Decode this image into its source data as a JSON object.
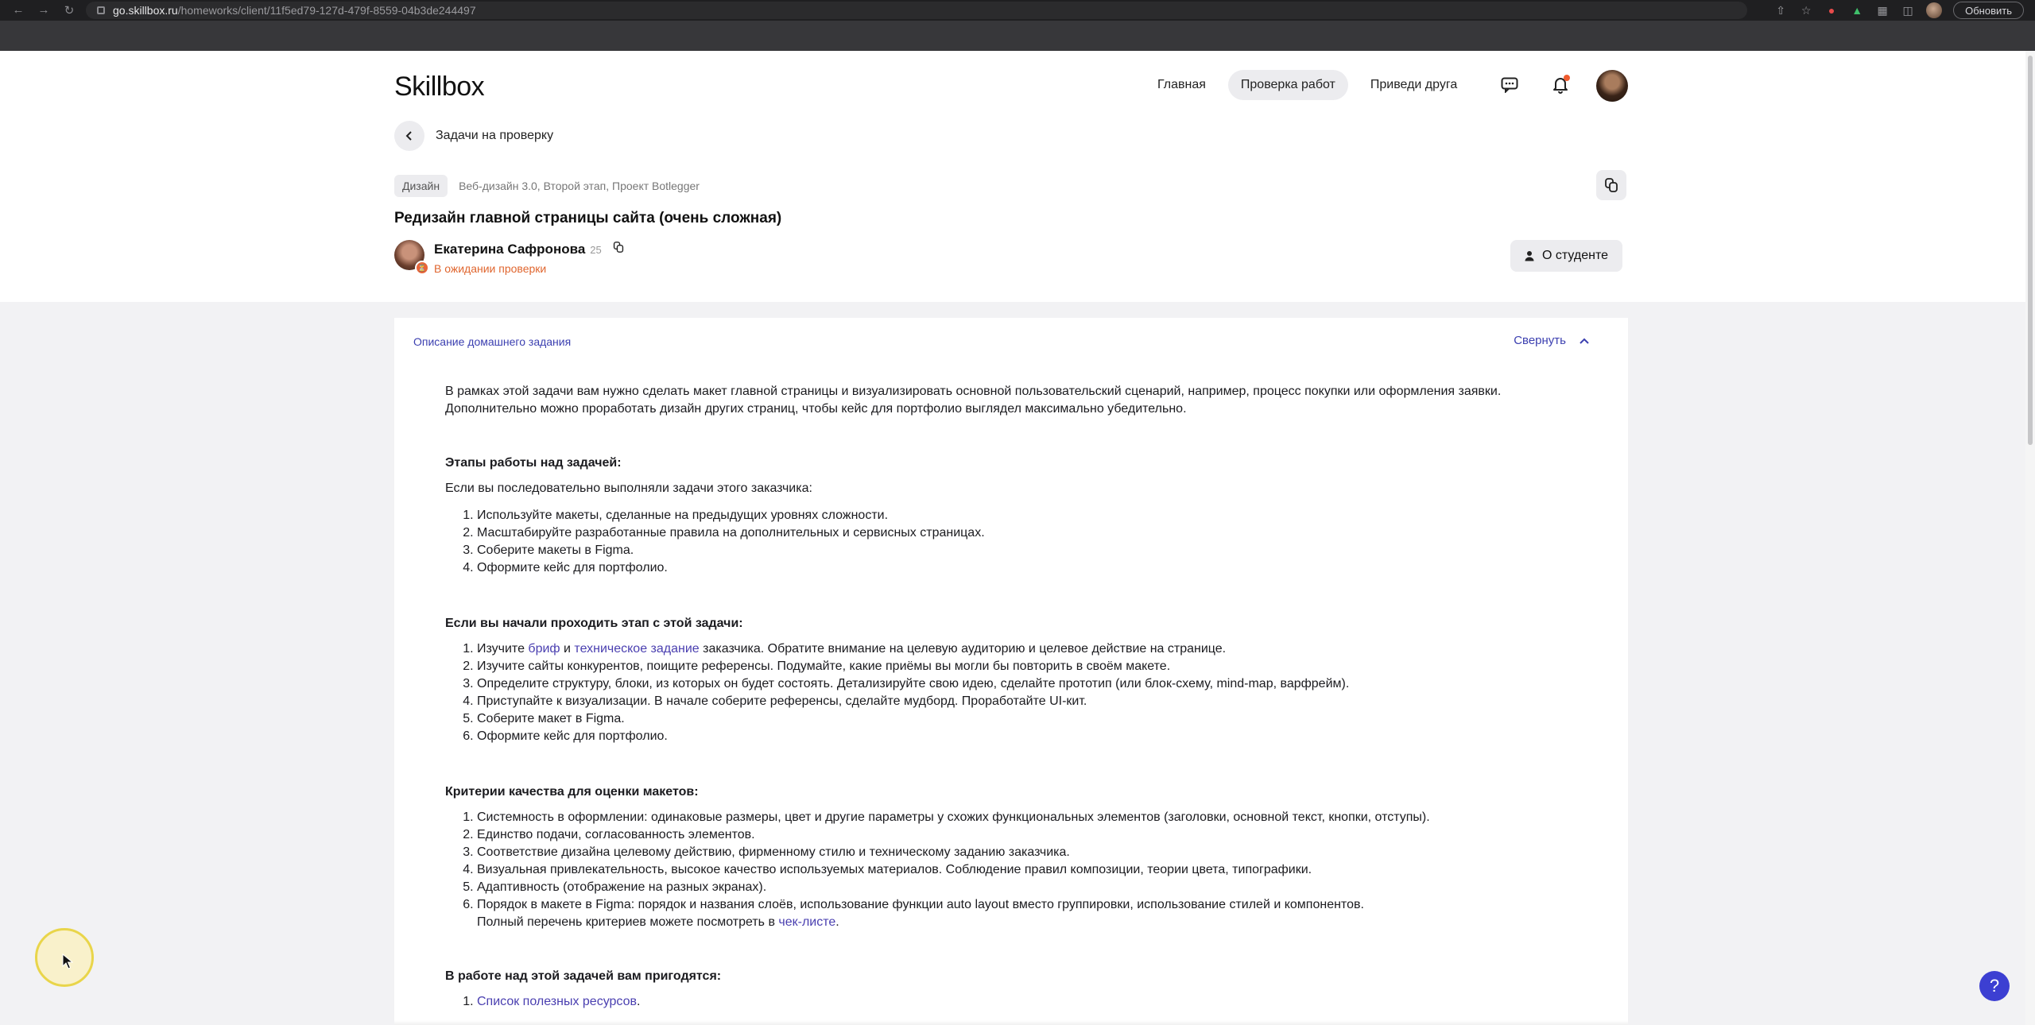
{
  "browser": {
    "url_host": "go.skillbox.ru",
    "url_path": "/homeworks/client/11f5ed79-127d-479f-8559-04b3de244497",
    "update_label": "Обновить"
  },
  "header": {
    "logo": "Skillbox",
    "nav": [
      {
        "label": "Главная"
      },
      {
        "label": "Проверка работ"
      },
      {
        "label": "Приведи друга"
      }
    ]
  },
  "back": {
    "label": "Задачи на проверку"
  },
  "task": {
    "tag": "Дизайн",
    "path": "Веб-дизайн 3.0, Второй этап, Проект Botlegger",
    "title": "Редизайн главной страницы сайта (очень сложная)"
  },
  "student": {
    "name": "Екатерина Сафронова",
    "age": "25",
    "status": "В ожидании проверки",
    "about_label": "О студенте"
  },
  "description": {
    "header": "Описание домашнего задания",
    "collapse_label": "Свернуть",
    "intro_1": "В рамках этой задачи вам нужно сделать макет главной страницы и визуализировать основной пользовательский сценарий, например, процесс покупки или оформления заявки.",
    "intro_2": "Дополнительно можно проработать дизайн других страниц, чтобы кейс для портфолио выглядел максимально убедительно.",
    "stages_title": "Этапы работы над задачей:",
    "stages_intro": "Если вы последовательно выполняли задачи этого заказчика:",
    "stages_list": [
      "Используйте макеты, сделанные на предыдущих уровнях сложности.",
      "Масштабируйте разработанные правила на дополнительных и сервисных страницах.",
      "Соберите макеты в Figma.",
      "Оформите кейс для портфолио."
    ],
    "start_title": "Если вы начали проходить этап с этой задачи:",
    "start_1_a": "Изучите ",
    "start_1_link1": "бриф",
    "start_1_b": " и ",
    "start_1_link2": "техническое задание",
    "start_1_c": " заказчика. Обратите внимание на целевую аудиторию и целевое действие на странице.",
    "start_list": [
      "Изучите сайты конкурентов, поищите референсы. Подумайте, какие приёмы вы могли бы повторить в своём макете.",
      "Определите структуру, блоки, из которых он будет состоять. Детализируйте свою идею, сделайте прототип (или блок-схему, mind-map, варфрейм).",
      "Приступайте к визуализации. В начале соберите референсы, сделайте мудборд. Проработайте UI-кит.",
      "Соберите макет в Figma.",
      "Оформите кейс для портфолио."
    ],
    "criteria_title": "Критерии качества для оценки макетов:",
    "criteria_list": [
      "Системность в оформлении: одинаковые размеры, цвет и другие параметры у схожих функциональных элементов (заголовки, основной текст, кнопки, отступы).",
      "Единство подачи, согласованность элементов.",
      "Соответствие дизайна целевому действию, фирменному стилю и техническому заданию заказчика.",
      "Визуальная привлекательность, высокое качество используемых материалов. Соблюдение правил композиции, теории цвета, типографики.",
      "Адаптивность (отображение на разных экранах)."
    ],
    "criteria_6": "Порядок в макете в Figma: порядок и названия слоёв, использование функции auto layout вместо группировки, использование стилей и компонентов.",
    "criteria_note_a": "Полный перечень критериев можете посмотреть в ",
    "criteria_note_link": "чек-листе",
    "criteria_note_b": ".",
    "useful_title": "В работе над этой задачей вам пригодятся:",
    "useful_link": "Список полезных ресурсов",
    "useful_after": "."
  },
  "help_label": "?"
}
